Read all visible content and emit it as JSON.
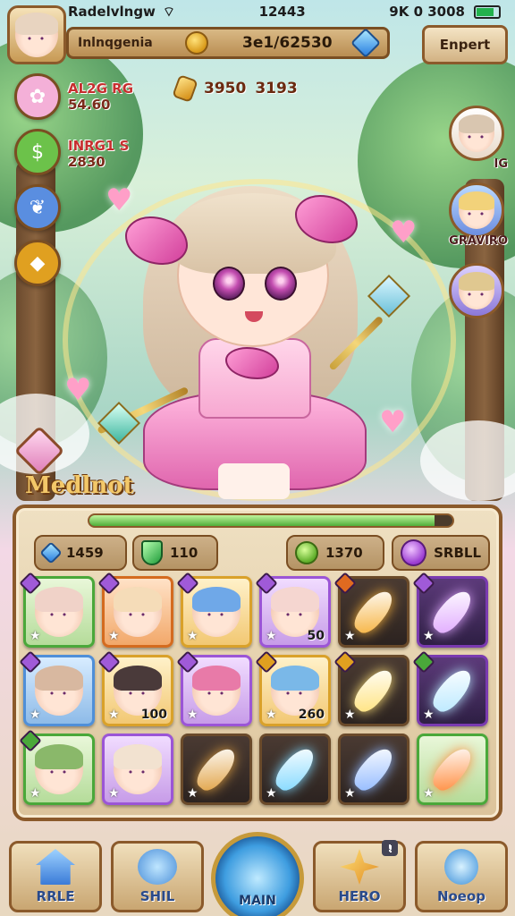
{
  "status_bar": {
    "carrier": "Radelvlngw",
    "time": "12443",
    "indicators": "9K 0 3008"
  },
  "header": {
    "player_name": "Inlnqgenia",
    "gold": "3e1/62530",
    "top_button": "Enpert"
  },
  "left_stats": [
    {
      "label": "AL2G RG",
      "value": "54.60",
      "color": "#f4b0d8",
      "icon": "fox-icon"
    },
    {
      "label": "INRG1 S",
      "value": "2830",
      "color": "#6cc24a",
      "icon": "coin-icon"
    },
    {
      "label": "",
      "value": "",
      "color": "#5a8ee0",
      "icon": "feather-icon"
    },
    {
      "label": "",
      "value": "",
      "color": "#e0a020",
      "icon": "crystal-icon"
    }
  ],
  "currency_row": {
    "a": "3950",
    "b": "3193"
  },
  "right_portraits": [
    {
      "label": "IG",
      "icon": "chibi-portrait"
    },
    {
      "label": "GRAVIRO",
      "icon": "duo-portrait"
    },
    {
      "label": "",
      "icon": "boy-portrait"
    }
  ],
  "hero": {
    "name": "Medlnot"
  },
  "panel": {
    "xp_fraction": 0.95,
    "resources": [
      {
        "value": "1459",
        "icon": "blue-gem-icon"
      },
      {
        "value": "110",
        "icon": "green-gem-icon"
      },
      {
        "value": "1370",
        "icon": "green-coin-icon"
      },
      {
        "value": "SRBLL",
        "icon": "purple-orb-icon"
      }
    ],
    "slots": [
      {
        "type": "char",
        "rarity": "r-green",
        "gem": "#a05ad8",
        "hair": "#f0d2c8",
        "num": ""
      },
      {
        "type": "char",
        "rarity": "r-orange",
        "gem": "#a05ad8",
        "hair": "#f5dcb8",
        "num": ""
      },
      {
        "type": "char",
        "rarity": "r-gold",
        "gem": "#a05ad8",
        "hair": "#6fa8e8",
        "num": ""
      },
      {
        "type": "char",
        "rarity": "r-purple",
        "gem": "#a05ad8",
        "hair": "#f5d6d0",
        "num": "50"
      },
      {
        "type": "item",
        "rarity": "r-dark",
        "gem": "#e06a20",
        "crystal": "#f6b13a",
        "num": ""
      },
      {
        "type": "item",
        "rarity": "r-dpurple",
        "gem": "#a05ad8",
        "crystal": "#e0a8ff",
        "num": ""
      },
      {
        "type": "char",
        "rarity": "r-blue",
        "gem": "#a05ad8",
        "hair": "#d8b8a0",
        "num": ""
      },
      {
        "type": "char",
        "rarity": "r-gold",
        "gem": "#a05ad8",
        "hair": "#4a3a3a",
        "num": "100"
      },
      {
        "type": "char",
        "rarity": "r-purple",
        "gem": "#a05ad8",
        "hair": "#e87aa8",
        "num": ""
      },
      {
        "type": "char",
        "rarity": "r-gold",
        "gem": "#e0a020",
        "hair": "#7ab8e8",
        "num": "260"
      },
      {
        "type": "item",
        "rarity": "r-dark",
        "gem": "#e0a020",
        "crystal": "#ffe27a",
        "num": ""
      },
      {
        "type": "item",
        "rarity": "r-dpurple",
        "gem": "#4aa83a",
        "crystal": "#b8e8ff",
        "num": ""
      },
      {
        "type": "char",
        "rarity": "r-green",
        "gem": "#4aa83a",
        "hair": "#8ab86a",
        "num": ""
      },
      {
        "type": "char",
        "rarity": "r-purple",
        "gem": "",
        "hair": "#f2e2d0",
        "num": ""
      },
      {
        "type": "item",
        "rarity": "r-dark",
        "gem": "",
        "crystal": "#e0a040",
        "num": ""
      },
      {
        "type": "item",
        "rarity": "r-dark",
        "gem": "",
        "crystal": "#7fd8ff",
        "num": ""
      },
      {
        "type": "item",
        "rarity": "r-dark",
        "gem": "",
        "crystal": "#8fb8ff",
        "num": ""
      },
      {
        "type": "item",
        "rarity": "r-green",
        "gem": "",
        "crystal": "#ff8a3a",
        "num": ""
      }
    ]
  },
  "nav": {
    "home": "RRLE",
    "skill": "SHIL",
    "main": "MAIN",
    "hero": "HERO",
    "shop": "Noeop",
    "hero_badge": "!"
  }
}
